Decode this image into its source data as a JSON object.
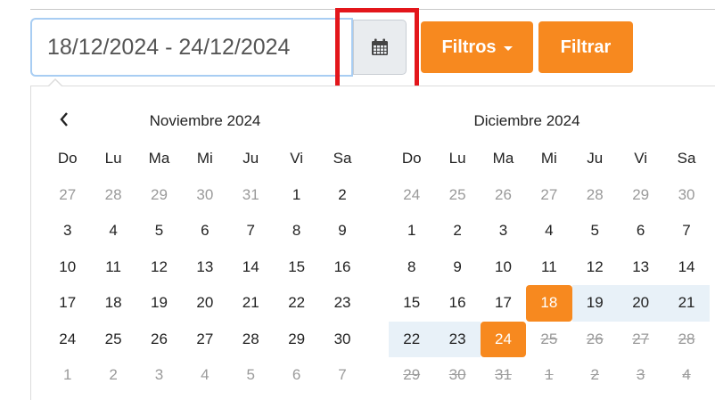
{
  "date_range": {
    "value": "18/12/2024 - 24/12/2024"
  },
  "buttons": {
    "filtros": "Filtros",
    "filtrar": "Filtrar"
  },
  "colors": {
    "accent": "#f7891f",
    "range": "#e8f1f8",
    "highlight": "#e3161b"
  },
  "calendar": {
    "weekdays": [
      "Do",
      "Lu",
      "Ma",
      "Mi",
      "Ju",
      "Vi",
      "Sa"
    ],
    "left": {
      "title": "Noviembre 2024",
      "weeks": [
        [
          {
            "d": "27",
            "s": "off"
          },
          {
            "d": "28",
            "s": "off"
          },
          {
            "d": "29",
            "s": "off"
          },
          {
            "d": "30",
            "s": "off"
          },
          {
            "d": "31",
            "s": "off"
          },
          {
            "d": "1",
            "s": ""
          },
          {
            "d": "2",
            "s": ""
          }
        ],
        [
          {
            "d": "3",
            "s": ""
          },
          {
            "d": "4",
            "s": ""
          },
          {
            "d": "5",
            "s": ""
          },
          {
            "d": "6",
            "s": ""
          },
          {
            "d": "7",
            "s": ""
          },
          {
            "d": "8",
            "s": ""
          },
          {
            "d": "9",
            "s": ""
          }
        ],
        [
          {
            "d": "10",
            "s": ""
          },
          {
            "d": "11",
            "s": ""
          },
          {
            "d": "12",
            "s": ""
          },
          {
            "d": "13",
            "s": ""
          },
          {
            "d": "14",
            "s": ""
          },
          {
            "d": "15",
            "s": ""
          },
          {
            "d": "16",
            "s": ""
          }
        ],
        [
          {
            "d": "17",
            "s": ""
          },
          {
            "d": "18",
            "s": ""
          },
          {
            "d": "19",
            "s": ""
          },
          {
            "d": "20",
            "s": ""
          },
          {
            "d": "21",
            "s": ""
          },
          {
            "d": "22",
            "s": ""
          },
          {
            "d": "23",
            "s": ""
          }
        ],
        [
          {
            "d": "24",
            "s": ""
          },
          {
            "d": "25",
            "s": ""
          },
          {
            "d": "26",
            "s": ""
          },
          {
            "d": "27",
            "s": ""
          },
          {
            "d": "28",
            "s": ""
          },
          {
            "d": "29",
            "s": ""
          },
          {
            "d": "30",
            "s": ""
          }
        ],
        [
          {
            "d": "1",
            "s": "off"
          },
          {
            "d": "2",
            "s": "off"
          },
          {
            "d": "3",
            "s": "off"
          },
          {
            "d": "4",
            "s": "off"
          },
          {
            "d": "5",
            "s": "off"
          },
          {
            "d": "6",
            "s": "off"
          },
          {
            "d": "7",
            "s": "off"
          }
        ]
      ]
    },
    "right": {
      "title": "Diciembre 2024",
      "weeks": [
        [
          {
            "d": "24",
            "s": "off"
          },
          {
            "d": "25",
            "s": "off"
          },
          {
            "d": "26",
            "s": "off"
          },
          {
            "d": "27",
            "s": "off"
          },
          {
            "d": "28",
            "s": "off"
          },
          {
            "d": "29",
            "s": "off"
          },
          {
            "d": "30",
            "s": "off"
          }
        ],
        [
          {
            "d": "1",
            "s": ""
          },
          {
            "d": "2",
            "s": ""
          },
          {
            "d": "3",
            "s": ""
          },
          {
            "d": "4",
            "s": ""
          },
          {
            "d": "5",
            "s": ""
          },
          {
            "d": "6",
            "s": ""
          },
          {
            "d": "7",
            "s": ""
          }
        ],
        [
          {
            "d": "8",
            "s": ""
          },
          {
            "d": "9",
            "s": ""
          },
          {
            "d": "10",
            "s": ""
          },
          {
            "d": "11",
            "s": ""
          },
          {
            "d": "12",
            "s": ""
          },
          {
            "d": "13",
            "s": ""
          },
          {
            "d": "14",
            "s": ""
          }
        ],
        [
          {
            "d": "15",
            "s": ""
          },
          {
            "d": "16",
            "s": ""
          },
          {
            "d": "17",
            "s": ""
          },
          {
            "d": "18",
            "s": "sel"
          },
          {
            "d": "19",
            "s": "in-range"
          },
          {
            "d": "20",
            "s": "in-range"
          },
          {
            "d": "21",
            "s": "in-range"
          }
        ],
        [
          {
            "d": "22",
            "s": "in-range"
          },
          {
            "d": "23",
            "s": "in-range"
          },
          {
            "d": "24",
            "s": "sel"
          },
          {
            "d": "25",
            "s": "disabled"
          },
          {
            "d": "26",
            "s": "disabled"
          },
          {
            "d": "27",
            "s": "disabled"
          },
          {
            "d": "28",
            "s": "disabled"
          }
        ],
        [
          {
            "d": "29",
            "s": "disabled"
          },
          {
            "d": "30",
            "s": "disabled"
          },
          {
            "d": "31",
            "s": "disabled"
          },
          {
            "d": "1",
            "s": "disabled"
          },
          {
            "d": "2",
            "s": "disabled"
          },
          {
            "d": "3",
            "s": "disabled"
          },
          {
            "d": "4",
            "s": "disabled"
          }
        ]
      ]
    }
  }
}
